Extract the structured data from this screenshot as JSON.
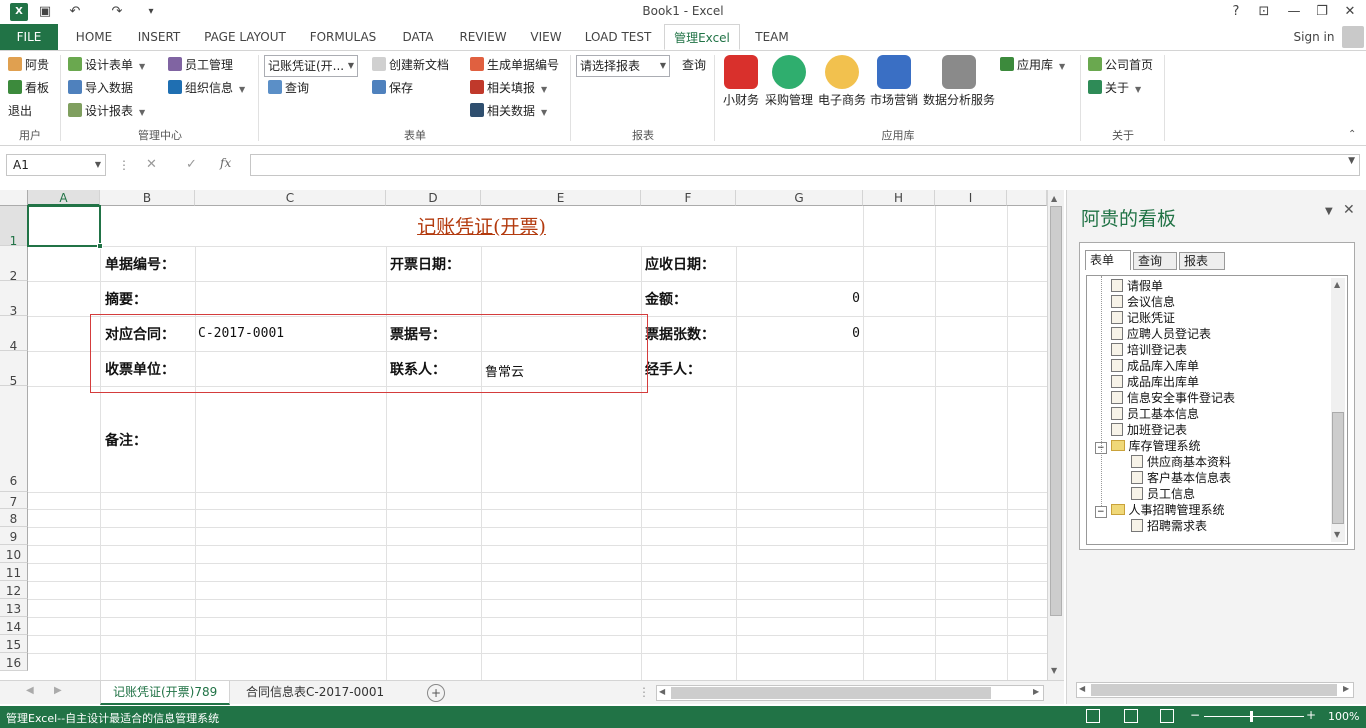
{
  "window": {
    "title": "Book1 - Excel",
    "help": "?",
    "min": "—",
    "restore": "❐",
    "close": "✕"
  },
  "qat": {
    "undo": "↶",
    "redo": "↷"
  },
  "tabs": [
    "FILE",
    "HOME",
    "INSERT",
    "PAGE LAYOUT",
    "FORMULAS",
    "DATA",
    "REVIEW",
    "VIEW",
    "LOAD TEST",
    "管理Excel",
    "TEAM"
  ],
  "signin": "Sign in",
  "ribbon": {
    "user": {
      "items": [
        "阿贵",
        "看板",
        "退出"
      ],
      "group": "用户"
    },
    "mgmt": {
      "items": [
        "设计表单",
        "导入数据",
        "设计报表",
        "员工管理",
        "组织信息"
      ],
      "group": "管理中心"
    },
    "form": {
      "combo": "记账凭证(开...",
      "query": "查询",
      "new_doc": "创建新文档",
      "save": "保存",
      "gen_no": "生成单据编号",
      "fill": "相关填报",
      "data": "相关数据",
      "group": "表单"
    },
    "report": {
      "combo": "请选择报表",
      "query": "查询",
      "group": "报表"
    },
    "apps": {
      "items": [
        "小财务",
        "采购管理",
        "电子商务",
        "市场营销",
        "数据分析服务"
      ],
      "lib": "应用库",
      "group": "应用库"
    },
    "about": {
      "home": "公司首页",
      "about": "关于",
      "group": "关于"
    }
  },
  "formula": {
    "namebox": "A1",
    "cancel": "✕",
    "enter": "✓",
    "fx": "fx",
    "value": ""
  },
  "grid": {
    "columns": [
      "A",
      "B",
      "C",
      "D",
      "E",
      "F",
      "G",
      "H",
      "I"
    ],
    "rows": [
      "1",
      "2",
      "3",
      "4",
      "5",
      "6",
      "7",
      "8",
      "9",
      "10",
      "11",
      "12",
      "13",
      "14",
      "15",
      "16"
    ],
    "title": "记账凭证(开票)",
    "labels": {
      "doc_no": "单据编号：",
      "issue_date": "开票日期：",
      "recv_date": "应收日期：",
      "summary": "摘要：",
      "amount": "金额：",
      "contract": "对应合同：",
      "ticket_no": "票据号：",
      "ticket_count": "票据张数：",
      "payee": "收票单位：",
      "contact": "联系人：",
      "handler": "经手人：",
      "remark": "备注："
    },
    "values": {
      "amount": "0",
      "contract": "C-2017-0001",
      "ticket_count": "0",
      "contact": "鲁常云"
    }
  },
  "sheets": [
    "记账凭证(开票)789",
    "合同信息表C-2017-0001"
  ],
  "status": {
    "text": "管理Excel--自主设计最适合的信息管理系统",
    "zoom": "100%"
  },
  "pane": {
    "title": "阿贵的看板",
    "tabs": [
      "表单",
      "查询",
      "报表"
    ],
    "tree": [
      "请假单",
      "会议信息",
      "记账凭证",
      "应聘人员登记表",
      "培训登记表",
      "成品库入库单",
      "成品库出库单",
      "信息安全事件登记表",
      "员工基本信息",
      "加班登记表",
      "库存管理系统",
      "供应商基本资料",
      "客户基本信息表",
      "员工信息",
      "人事招聘管理系统",
      "招聘需求表"
    ]
  }
}
